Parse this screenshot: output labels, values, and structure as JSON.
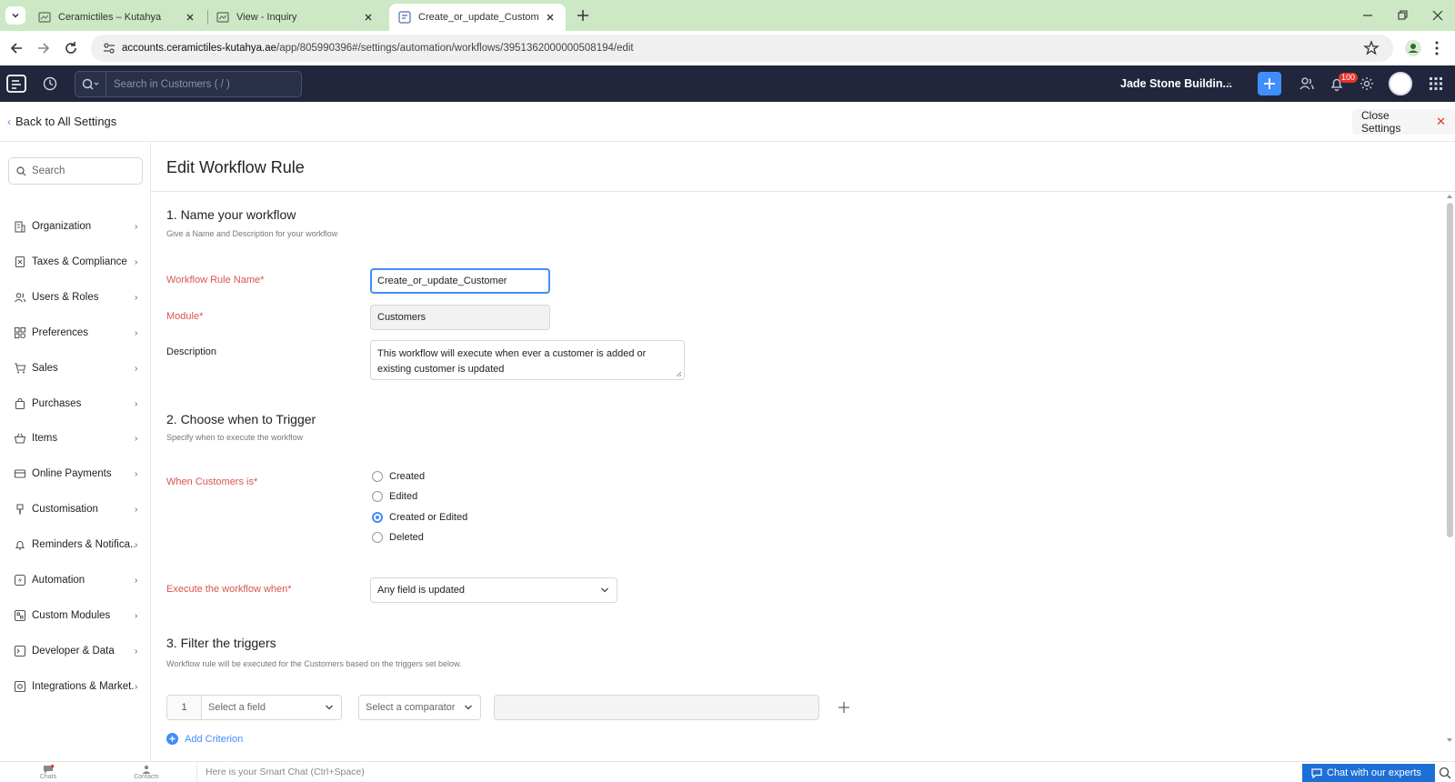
{
  "browser": {
    "tabs": [
      {
        "title": "Ceramictiles – Kutahya"
      },
      {
        "title": "View - Inquiry"
      },
      {
        "title": "Create_or_update_Customer | V"
      }
    ],
    "url_host": "accounts.ceramictiles-kutahya.ae",
    "url_path": "/app/805990396#/settings/automation/workflows/3951362000000508194/edit"
  },
  "header": {
    "search_placeholder": "Search in Customers ( / )",
    "org_name": "Jade Stone Buildin...",
    "notifications_count": "100"
  },
  "settings_bar": {
    "back_label": "Back to All Settings",
    "close_label": "Close Settings"
  },
  "sidebar": {
    "search_placeholder": "Search",
    "items": [
      {
        "label": "Organization",
        "icon": "building-icon"
      },
      {
        "label": "Taxes & Compliance",
        "icon": "tax-document-icon"
      },
      {
        "label": "Users & Roles",
        "icon": "users-icon"
      },
      {
        "label": "Preferences",
        "icon": "preferences-icon"
      },
      {
        "label": "Sales",
        "icon": "cart-icon"
      },
      {
        "label": "Purchases",
        "icon": "bag-icon"
      },
      {
        "label": "Items",
        "icon": "basket-icon"
      },
      {
        "label": "Online Payments",
        "icon": "card-icon"
      },
      {
        "label": "Customisation",
        "icon": "brush-icon"
      },
      {
        "label": "Reminders & Notifica...",
        "icon": "bell-icon"
      },
      {
        "label": "Automation",
        "icon": "lightning-icon"
      },
      {
        "label": "Custom Modules",
        "icon": "module-icon"
      },
      {
        "label": "Developer & Data",
        "icon": "terminal-icon"
      },
      {
        "label": "Integrations & Market...",
        "icon": "integration-icon"
      }
    ]
  },
  "main": {
    "title": "Edit Workflow Rule",
    "section1": {
      "heading": "1. Name your workflow",
      "sub": "Give a Name and Description for your workflow",
      "name_label": "Workflow Rule Name*",
      "name_value": "Create_or_update_Customer",
      "module_label": "Module*",
      "module_value": "Customers",
      "description_label": "Description",
      "description_value": "This workflow will execute when ever a customer is added or existing customer is updated"
    },
    "section2": {
      "heading": "2. Choose when to Trigger",
      "sub": "Specify when to execute the workflow",
      "when_label": "When Customers is*",
      "options": [
        "Created",
        "Edited",
        "Created or Edited",
        "Deleted"
      ],
      "selected": "Created or Edited",
      "execute_label": "Execute the workflow when*",
      "execute_value": "Any field is updated"
    },
    "section3": {
      "heading": "3. Filter the triggers",
      "sub": "Workflow rule will be executed for the Customers based on the triggers set below.",
      "criterion_number": "1",
      "field_placeholder": "Select a field",
      "comparator_placeholder": "Select a comparator",
      "add_criterion_label": "Add Criterion"
    }
  },
  "bottom_bar": {
    "chats_label": "Chats",
    "contacts_label": "Contacts",
    "smart_chat_placeholder": "Here is your Smart Chat (Ctrl+Space)",
    "chat_experts_label": "Chat with our experts"
  },
  "colors": {
    "accent": "#408dfb",
    "required": "#d9534f",
    "header_bg": "#21263c",
    "tabbar_bg": "#cde8c4"
  }
}
